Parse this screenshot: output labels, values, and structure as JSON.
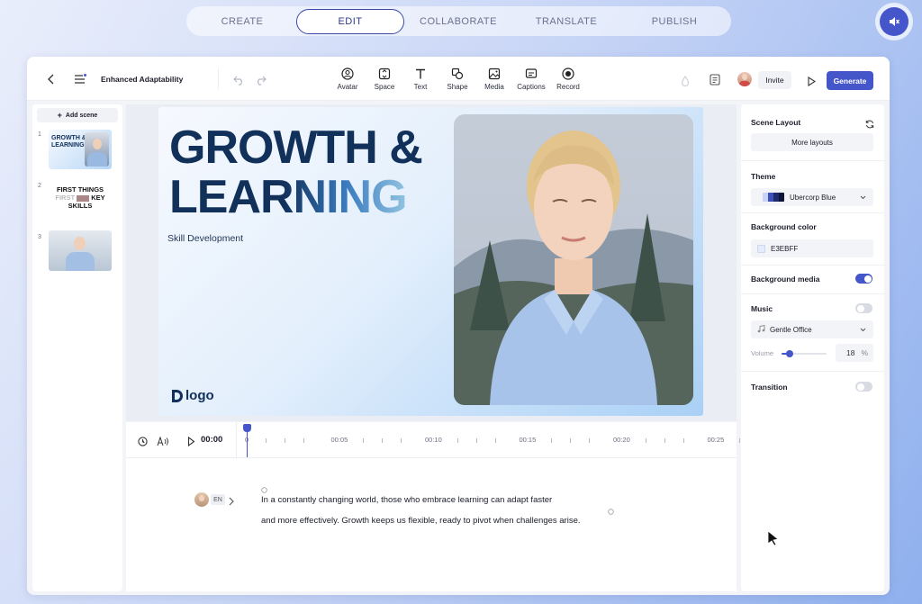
{
  "steps": [
    {
      "label": "CREATE"
    },
    {
      "label": "EDIT"
    },
    {
      "label": "COLLABORATE"
    },
    {
      "label": "TRANSLATE"
    },
    {
      "label": "PUBLISH"
    }
  ],
  "toolbar": {
    "project_title": "Enhanced Adaptability",
    "tools": [
      {
        "label": "Avatar",
        "icon": "avatar-icon"
      },
      {
        "label": "Space",
        "icon": "space-icon"
      },
      {
        "label": "Text",
        "icon": "text-icon"
      },
      {
        "label": "Shape",
        "icon": "shape-icon"
      },
      {
        "label": "Media",
        "icon": "media-icon"
      },
      {
        "label": "Captions",
        "icon": "captions-icon"
      },
      {
        "label": "Record",
        "icon": "record-icon"
      }
    ],
    "invite_label": "Invite",
    "generate_label": "Generate"
  },
  "scenes": {
    "add_label": "Add scene",
    "items": [
      {
        "num": "1",
        "title_l1": "GROWTH &",
        "title_l2": "LEARNING"
      },
      {
        "num": "2",
        "line1": "FIRST THINGS",
        "line2_a": "FIRST",
        "line2_b": "KEY",
        "line3": "SKILLS"
      },
      {
        "num": "3"
      }
    ]
  },
  "slide": {
    "title_line1": "GROWTH &",
    "title_line2": "LEARNING",
    "subtitle": "Skill Development",
    "logo_text": "logo"
  },
  "timeline": {
    "current_time": "00:00",
    "ticks": [
      "0",
      "00:05",
      "00:10",
      "00:15",
      "00:20",
      "00:25"
    ]
  },
  "script": {
    "language": "EN",
    "line1": "In a constantly changing world, those who embrace learning can adapt faster",
    "line2": "and more effectively. Growth keeps us flexible, ready to pivot when challenges arise."
  },
  "properties": {
    "scene_layout_label": "Scene Layout",
    "more_layouts_label": "More layouts",
    "theme_label": "Theme",
    "theme_value": "Ubercorp Blue",
    "bg_color_label": "Background color",
    "bg_color_value": "E3EBFF",
    "bg_media_label": "Background media",
    "bg_media_on": true,
    "music_label": "Music",
    "music_on": false,
    "music_value": "Gentle Office",
    "volume_label": "Volume",
    "volume_value": "18",
    "volume_unit": "%",
    "transition_label": "Transition",
    "transition_on": false
  },
  "colors": {
    "accent": "#4456c9",
    "slide_title": "#11305a",
    "bg_color_swatch": "#E3EBFF"
  }
}
